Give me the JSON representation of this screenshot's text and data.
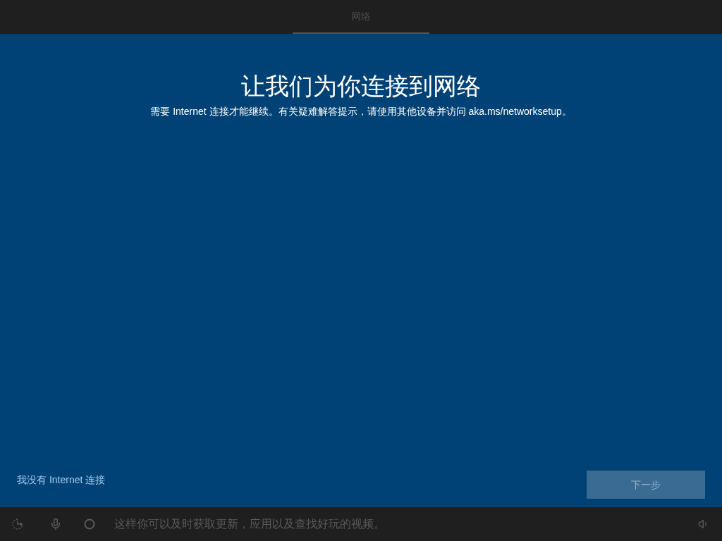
{
  "tabs": [
    {
      "label": "网络",
      "selected": true
    }
  ],
  "heading": "让我们为你连接到网络",
  "subtitle": "需要 Internet 连接才能继续。有关疑难解答提示，请使用其他设备并访问 aka.ms/networksetup。",
  "skip_link": "我没有 Internet 连接",
  "next_button": {
    "label": "下一步",
    "disabled": true
  },
  "status_bar": {
    "caption": "这样你可以及时获取更新，应用以及查找好玩的视频。"
  }
}
